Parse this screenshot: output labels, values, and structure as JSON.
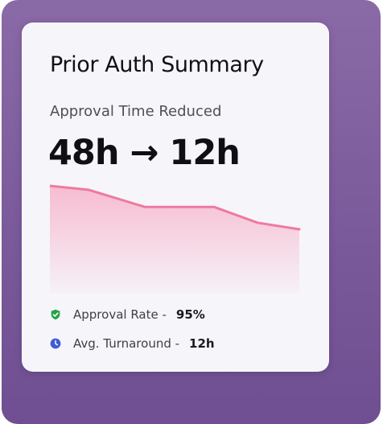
{
  "card": {
    "title": "Prior Auth Summary",
    "subtitle": "Approval Time Reduced",
    "metric": "48h → 12h"
  },
  "trend": {
    "line_color": "#ee7aa0",
    "fill_color": "#f7b6cc",
    "values": [
      48,
      45,
      32,
      32,
      20,
      15
    ]
  },
  "stats": [
    {
      "icon": "shield-check-icon",
      "label": "Approval Rate -",
      "value": "95%",
      "color": "#22a34a"
    },
    {
      "icon": "clock-icon",
      "label": "Avg. Turnaround -",
      "value": "12h",
      "color": "#3f5bd6"
    }
  ],
  "colors": {
    "backdrop": "#7b5a9b",
    "card": "#f6f5fa"
  }
}
